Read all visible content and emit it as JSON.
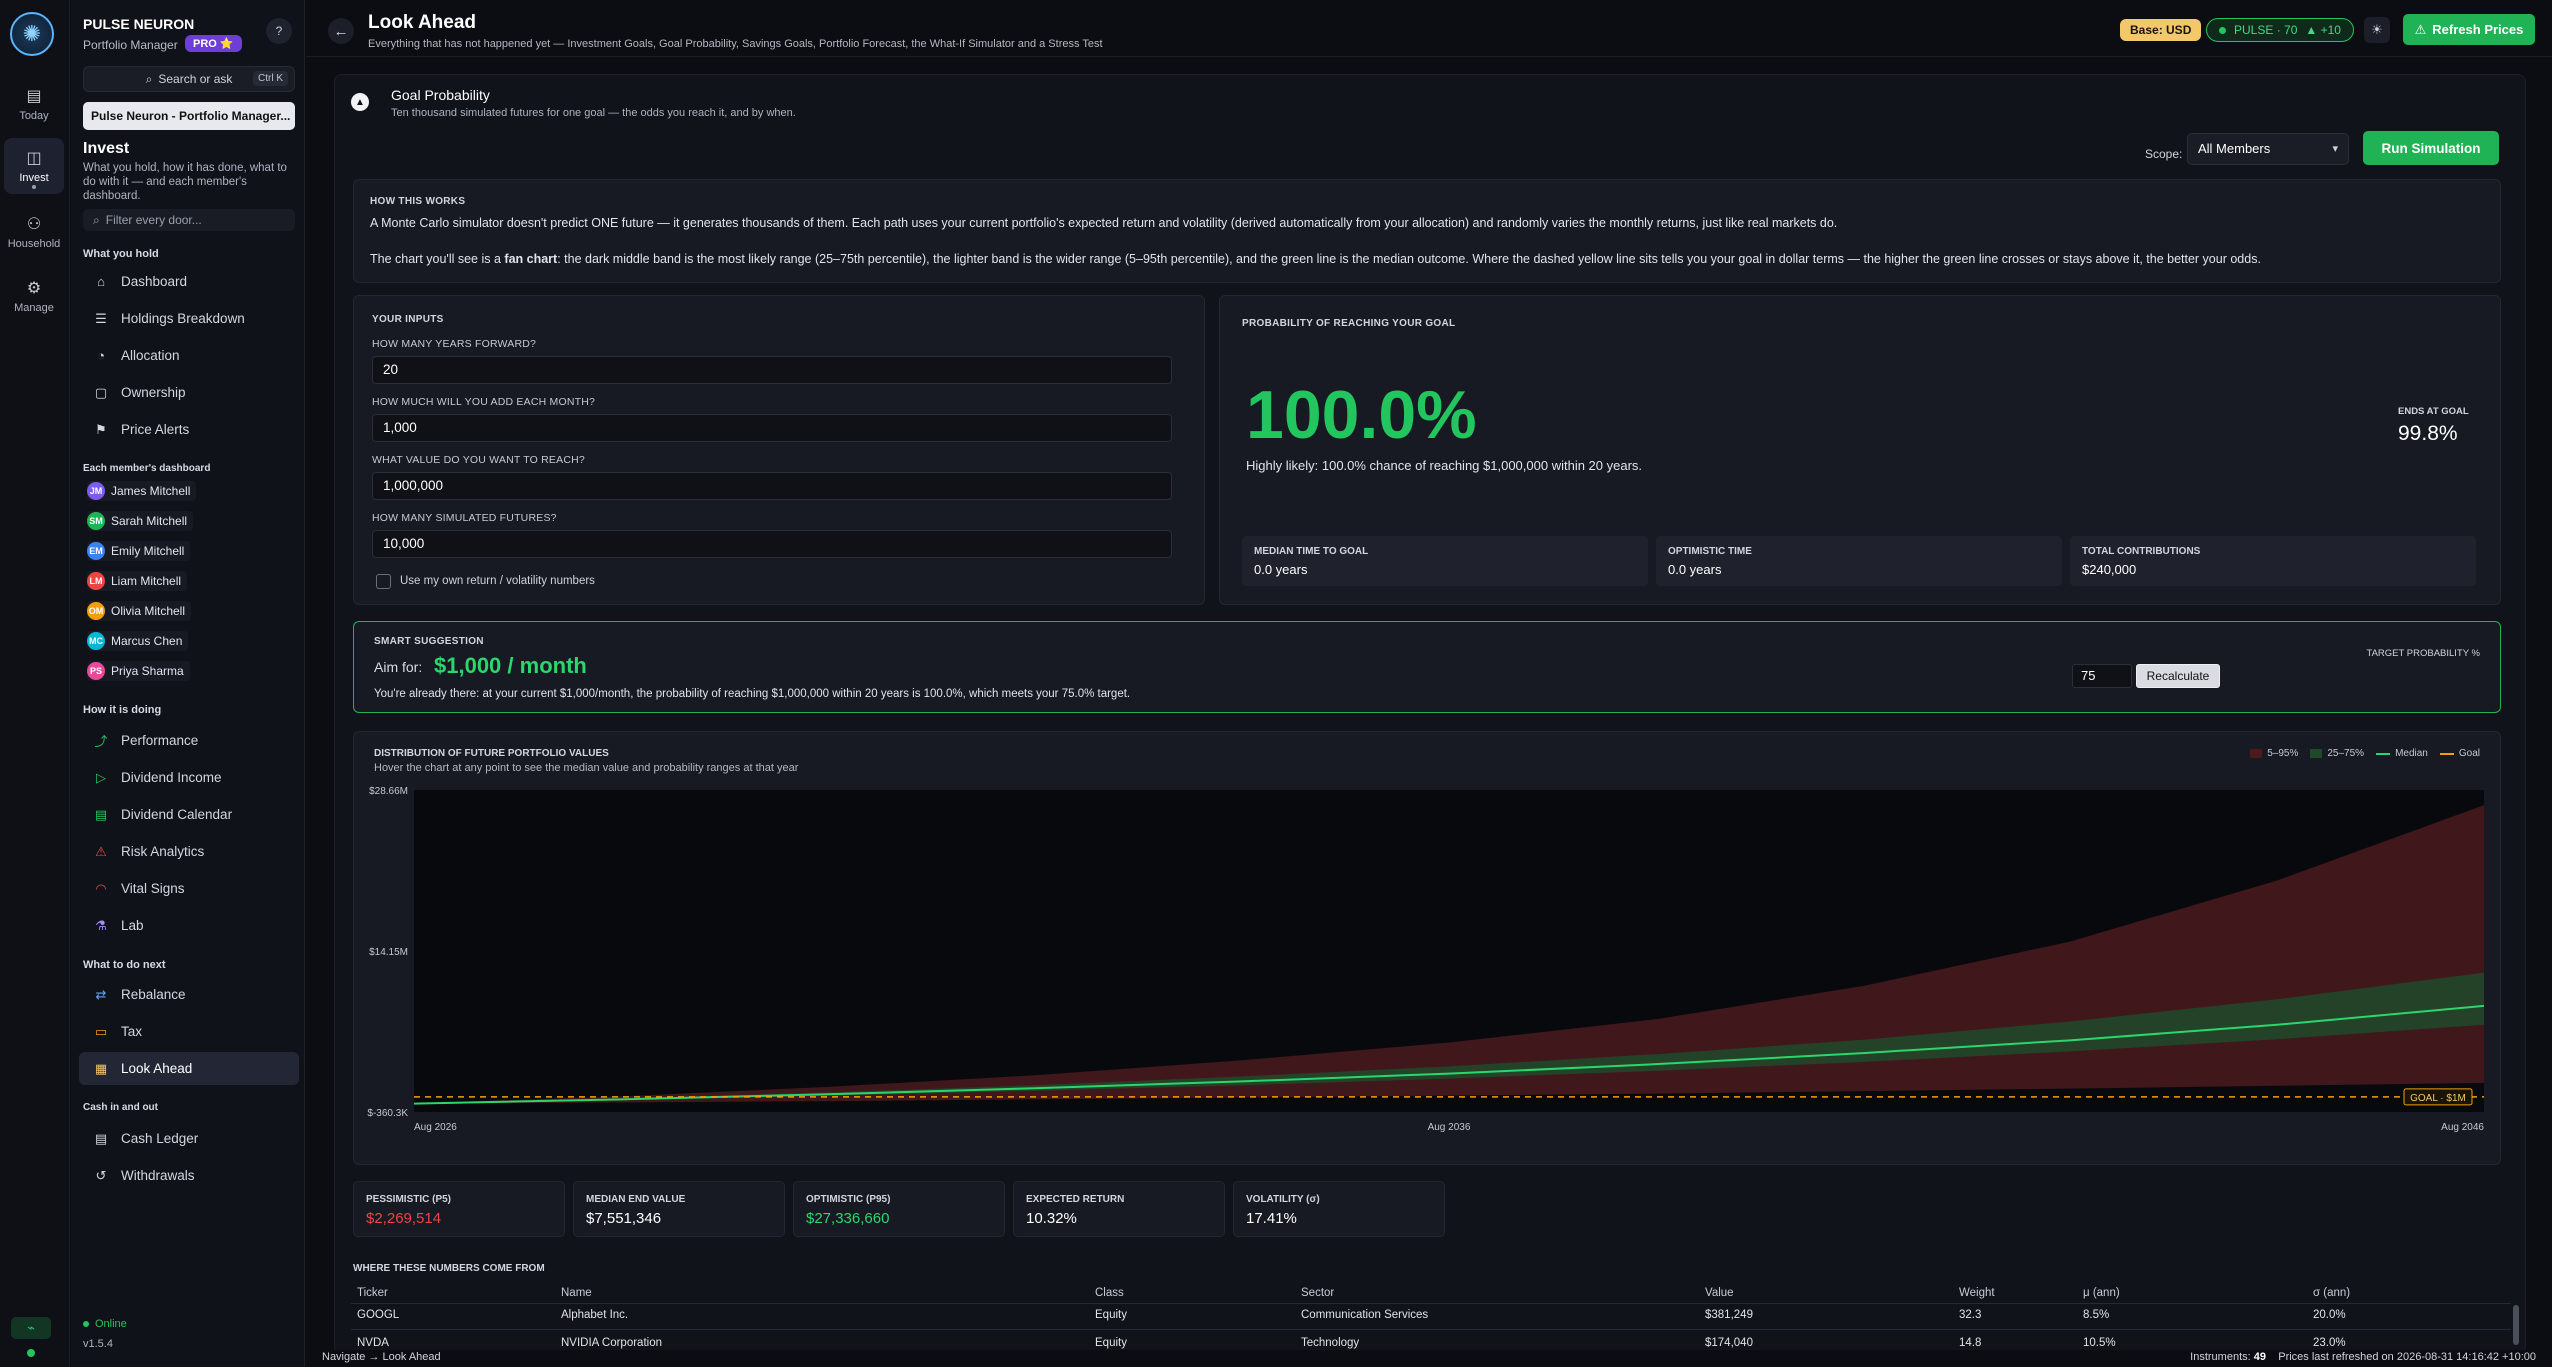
{
  "rail": {
    "items": [
      {
        "label": "Today",
        "icon": "calendar-icon"
      },
      {
        "label": "Invest",
        "icon": "chart-icon"
      },
      {
        "label": "Household",
        "icon": "people-icon"
      },
      {
        "label": "Manage",
        "icon": "gear-icon"
      }
    ]
  },
  "brand": {
    "title": "PULSE NEURON",
    "subtitle": "Portfolio Manager",
    "badge": "PRO ⭐",
    "help": "?"
  },
  "sidebar": {
    "search_label": "Search or ask",
    "search_kbd": "Ctrl K",
    "portfolio": "Pulse Neuron - Portfolio Manager...",
    "section_title": "Invest",
    "section_desc": "What you hold, how it has done, what to do with it — and each member's dashboard.",
    "filter_placeholder": "Filter every door...",
    "group_hold": "What you hold",
    "hold_items": [
      "Dashboard",
      "Holdings Breakdown",
      "Allocation",
      "Ownership",
      "Price Alerts"
    ],
    "group_members": "Each member's dashboard",
    "members": [
      {
        "initials": "JM",
        "name": "James Mitchell",
        "color": "#7c5cf0"
      },
      {
        "initials": "SM",
        "name": "Sarah Mitchell",
        "color": "#1fb356"
      },
      {
        "initials": "EM",
        "name": "Emily Mitchell",
        "color": "#3b82f6"
      },
      {
        "initials": "LM",
        "name": "Liam Mitchell",
        "color": "#ef4444"
      },
      {
        "initials": "OM",
        "name": "Olivia Mitchell",
        "color": "#f59e0b"
      },
      {
        "initials": "MC",
        "name": "Marcus Chen",
        "color": "#06b6d4"
      },
      {
        "initials": "PS",
        "name": "Priya Sharma",
        "color": "#ec4899"
      }
    ],
    "group_doing": "How it is doing",
    "doing_items": [
      "Performance",
      "Dividend Income",
      "Dividend Calendar",
      "Risk Analytics",
      "Vital Signs",
      "Lab"
    ],
    "group_next": "What to do next",
    "next_items": [
      "Rebalance",
      "Tax",
      "Look Ahead"
    ],
    "group_cash": "Cash in and out",
    "cash_items": [
      "Cash Ledger",
      "Withdrawals"
    ],
    "status": "Online",
    "version": "v1.5.4"
  },
  "header": {
    "title": "Look Ahead",
    "subtitle": "Everything that has not happened yet — Investment Goals, Goal Probability, Savings Goals, Portfolio Forecast, the What-If Simulator and a Stress Test",
    "base": "Base: USD",
    "pulse": "PULSE · 70",
    "pulse_delta": "▲ +10",
    "refresh": "Refresh Prices"
  },
  "goal_probability": {
    "title": "Goal Probability",
    "subtitle": "Ten thousand simulated futures for one goal — the odds you reach it, and by when.",
    "scope_label": "Scope:",
    "scope_value": "All Members",
    "run_button": "Run Simulation"
  },
  "how": {
    "label": "HOW THIS WORKS",
    "p1": "A Monte Carlo simulator doesn't predict ONE future — it generates thousands of them. Each path uses your current portfolio's expected return and volatility (derived automatically from your allocation) and randomly varies the monthly returns, just like real markets do.",
    "p2a": "The chart you'll see is a ",
    "p2b": "fan chart",
    "p2c": ": the dark middle band is the most likely range (25–75th percentile), the lighter band is the wider range (5–95th percentile), and the green line is the median outcome. Where the dashed yellow line sits tells you your goal in dollar terms — the higher the green line crosses or stays above it, the better your odds."
  },
  "inputs": {
    "label": "YOUR INPUTS",
    "years_label": "HOW MANY YEARS FORWARD?",
    "years": "20",
    "monthly_label": "HOW MUCH WILL YOU ADD EACH MONTH?",
    "monthly": "1,000",
    "target_label": "WHAT VALUE DO YOU WANT TO REACH?",
    "target": "1,000,000",
    "sims_label": "HOW MANY SIMULATED FUTURES?",
    "sims": "10,000",
    "own_label": "Use my own return / volatility numbers"
  },
  "probability": {
    "label": "PROBABILITY OF REACHING YOUR GOAL",
    "value": "100.0%",
    "text": "Highly likely: 100.0% chance of reaching $1,000,000 within 20 years.",
    "ends_label": "ENDS AT GOAL",
    "ends_value": "99.8%",
    "median_label": "MEDIAN TIME TO GOAL",
    "median_value": "0.0 years",
    "optimistic_label": "OPTIMISTIC TIME",
    "optimistic_value": "0.0 years",
    "contrib_label": "TOTAL CONTRIBUTIONS",
    "contrib_value": "$240,000"
  },
  "smart": {
    "label": "SMART SUGGESTION",
    "aim": "Aim for:",
    "value": "$1,000 / month",
    "text": "You're already there: at your current $1,000/month, the probability of reaching $1,000,000 within 20 years is 100.0%, which meets your 75.0% target.",
    "tp_label": "TARGET PROBABILITY %",
    "tp_value": "75",
    "recalc": "Recalculate"
  },
  "chart_data": {
    "type": "area",
    "title": "DISTRIBUTION OF FUTURE PORTFOLIO VALUES",
    "subtitle": "Hover the chart at any point to see the median value and probability ranges at that year",
    "x": [
      2026.58,
      2028.58,
      2030.58,
      2032.58,
      2034.58,
      2036.58,
      2038.58,
      2040.58,
      2042.58,
      2044.58,
      2046.58
    ],
    "x_ticks": [
      "Aug 2026",
      "Aug 2036",
      "Aug 2046"
    ],
    "y_ticks": [
      "$28.66M",
      "$14.15M",
      "$-360.3K"
    ],
    "ylim": [
      -0.3603,
      28.66
    ],
    "series": [
      {
        "name": "5–95%",
        "low": [
          0.38,
          0.5,
          0.62,
          0.78,
          0.95,
          1.12,
          1.3,
          1.52,
          1.75,
          2.0,
          2.27
        ],
        "high": [
          0.42,
          1.05,
          1.9,
          2.95,
          4.3,
          5.9,
          8.0,
          11.0,
          15.0,
          20.5,
          27.3
        ]
      },
      {
        "name": "25–75%",
        "low": [
          0.4,
          0.72,
          1.1,
          1.55,
          2.05,
          2.65,
          3.35,
          4.15,
          5.1,
          6.2,
          7.5
        ],
        "high": [
          0.41,
          0.85,
          1.4,
          2.05,
          2.85,
          3.75,
          4.85,
          6.15,
          7.8,
          9.8,
          12.2
        ]
      },
      {
        "name": "Median",
        "values": [
          0.4,
          0.78,
          1.24,
          1.78,
          2.4,
          3.1,
          3.95,
          4.95,
          6.1,
          7.5,
          9.2
        ]
      },
      {
        "name": "Goal",
        "values": [
          1,
          1,
          1,
          1,
          1,
          1,
          1,
          1,
          1,
          1,
          1
        ]
      }
    ],
    "goal_label": "GOAL · $1M",
    "colors": {
      "outer": "#4a1a1f",
      "inner": "#1f4a2a",
      "median": "#2bd66c",
      "goal": "#f59e0b"
    },
    "legend": "top-right"
  },
  "stats": [
    {
      "label": "PESSIMISTIC (P5)",
      "value": "$2,269,514",
      "color": "#ef4444"
    },
    {
      "label": "MEDIAN END VALUE",
      "value": "$7,551,346",
      "color": "#ffffff"
    },
    {
      "label": "OPTIMISTIC (P95)",
      "value": "$27,336,660",
      "color": "#2bd66c"
    },
    {
      "label": "EXPECTED RETURN",
      "value": "10.32%",
      "color": "#ffffff"
    },
    {
      "label": "VOLATILITY (σ)",
      "value": "17.41%",
      "color": "#ffffff"
    }
  ],
  "table": {
    "title": "WHERE THESE NUMBERS COME FROM",
    "headers": [
      "Ticker",
      "Name",
      "Class",
      "Sector",
      "Value",
      "Weight",
      "μ (ann)",
      "σ (ann)"
    ],
    "rows": [
      [
        "GOOGL",
        "Alphabet Inc.",
        "Equity",
        "Communication Services",
        "$381,249",
        "32.3",
        "8.5%",
        "20.0%"
      ],
      [
        "NVDA",
        "NVIDIA Corporation",
        "Equity",
        "Technology",
        "$174,040",
        "14.8",
        "10.5%",
        "23.0%"
      ]
    ]
  },
  "statusbar": {
    "nav": "Navigate → Look Ahead",
    "instruments_label": "Instruments:",
    "instruments": "49",
    "refreshed": "Prices last refreshed on 2026-08-31 14:16:42 +10:00"
  }
}
